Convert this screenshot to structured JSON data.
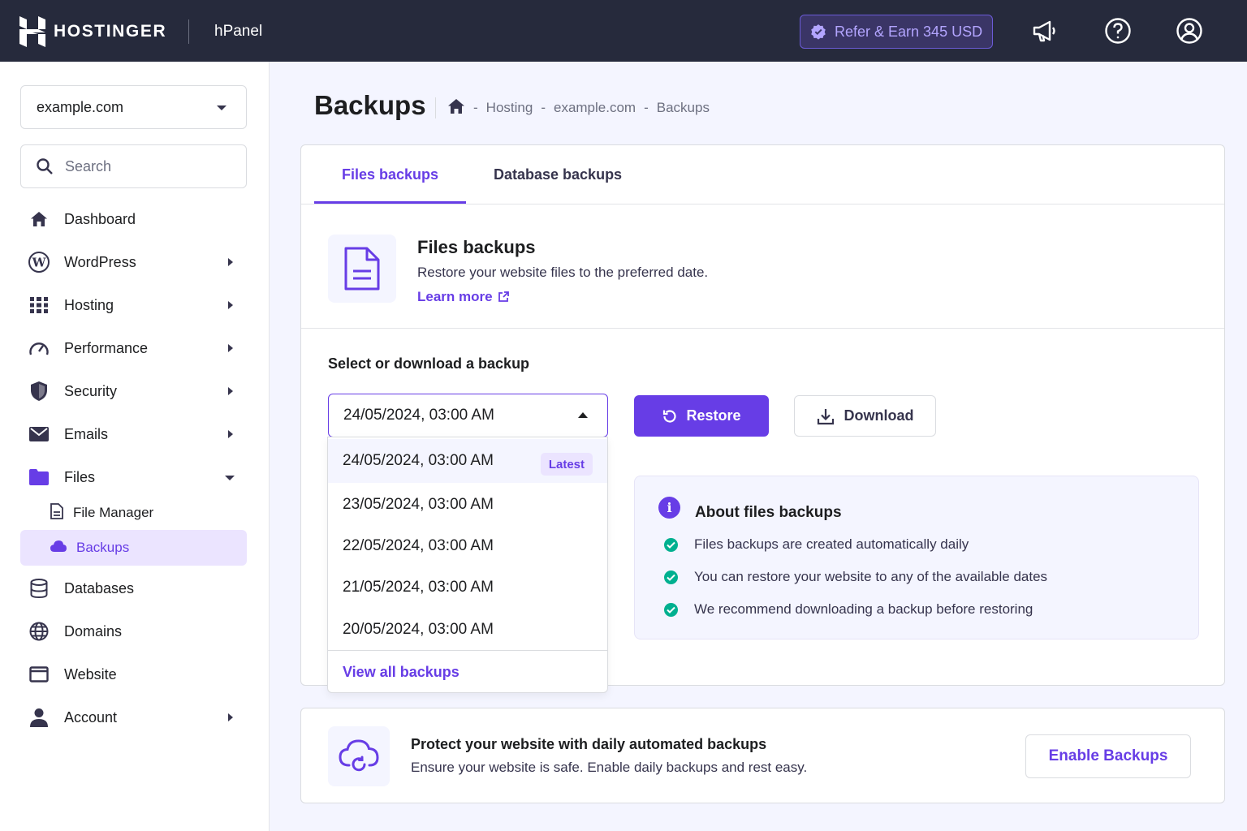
{
  "topbar": {
    "brand": "HOSTINGER",
    "panel": "hPanel",
    "refer_label": "Refer & Earn 345 USD",
    "icons": [
      "megaphone-icon",
      "help-icon",
      "account-icon"
    ]
  },
  "sidebar": {
    "domain": "example.com",
    "search_placeholder": "Search",
    "items": [
      {
        "label": "Dashboard",
        "icon": "home-icon"
      },
      {
        "label": "WordPress",
        "icon": "wordpress-icon"
      },
      {
        "label": "Hosting",
        "icon": "grid-icon"
      },
      {
        "label": "Performance",
        "icon": "gauge-icon"
      },
      {
        "label": "Security",
        "icon": "shield-icon"
      },
      {
        "label": "Emails",
        "icon": "mail-icon"
      },
      {
        "label": "Files",
        "icon": "folder-icon"
      },
      {
        "label": "Databases",
        "icon": "database-icon"
      },
      {
        "label": "Domains",
        "icon": "globe-icon"
      },
      {
        "label": "Website",
        "icon": "window-icon"
      },
      {
        "label": "Account",
        "icon": "user-icon"
      }
    ],
    "sub_items": [
      {
        "label": "File Manager",
        "icon": "file-icon"
      },
      {
        "label": "Backups",
        "icon": "cloud-icon"
      }
    ]
  },
  "page": {
    "title": "Backups",
    "breadcrumb": [
      "Hosting",
      "example.com",
      "Backups"
    ],
    "separator": "-"
  },
  "tabs": [
    "Files backups",
    "Database backups"
  ],
  "files_section": {
    "title": "Files backups",
    "description": "Restore your website files to the preferred date.",
    "learn_more": "Learn more"
  },
  "backup": {
    "select_label": "Select or download a backup",
    "selected": "24/05/2024, 03:00 AM",
    "options": [
      "24/05/2024, 03:00 AM",
      "23/05/2024, 03:00 AM",
      "22/05/2024, 03:00 AM",
      "21/05/2024, 03:00 AM",
      "20/05/2024, 03:00 AM"
    ],
    "latest_badge": "Latest",
    "view_all": "View all backups",
    "restore_label": "Restore",
    "download_label": "Download"
  },
  "about": {
    "title": "About files backups",
    "points": [
      "Files backups are created automatically daily",
      "You can restore your website to any of the available dates",
      "We recommend downloading a backup before restoring"
    ]
  },
  "promo": {
    "title": "Protect your website with daily automated backups",
    "description": "Ensure your website is safe. Enable daily backups and rest easy.",
    "button": "Enable Backups"
  },
  "colors": {
    "accent": "#673de6",
    "topbar": "#262a3c",
    "success": "#00b090"
  }
}
